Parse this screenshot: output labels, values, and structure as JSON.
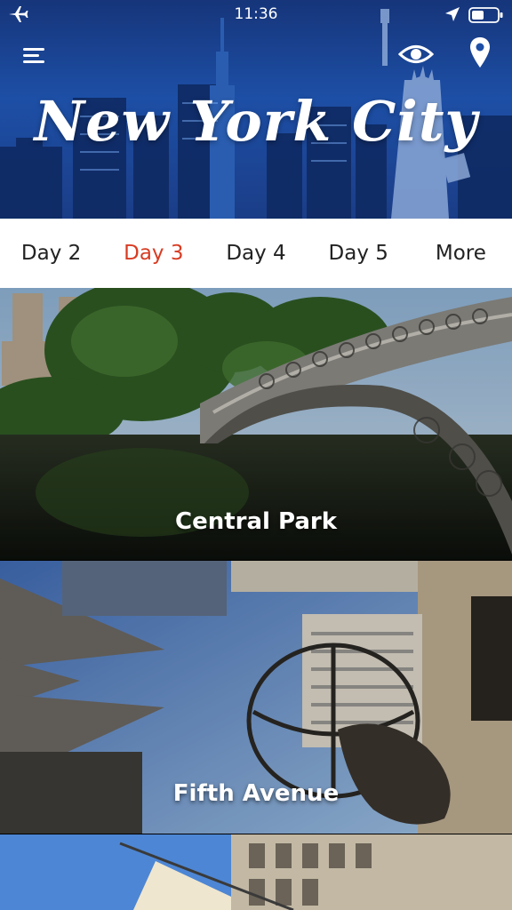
{
  "status": {
    "time": "11:36"
  },
  "header": {
    "title": "New York City"
  },
  "tabs": [
    {
      "label": "Day 2",
      "active": false
    },
    {
      "label": "Day 3",
      "active": true
    },
    {
      "label": "Day 4",
      "active": false
    },
    {
      "label": "Day 5",
      "active": false
    },
    {
      "label": "More",
      "active": false
    }
  ],
  "places": [
    {
      "name": "Central Park"
    },
    {
      "name": "Fifth Avenue"
    }
  ],
  "colors": {
    "active_tab": "#d83c23",
    "header_blue": "#1d4fa6"
  },
  "icons": [
    "airplane-icon",
    "location-arrow-icon",
    "battery-icon",
    "menu-icon",
    "eye-icon",
    "map-pin-icon"
  ]
}
